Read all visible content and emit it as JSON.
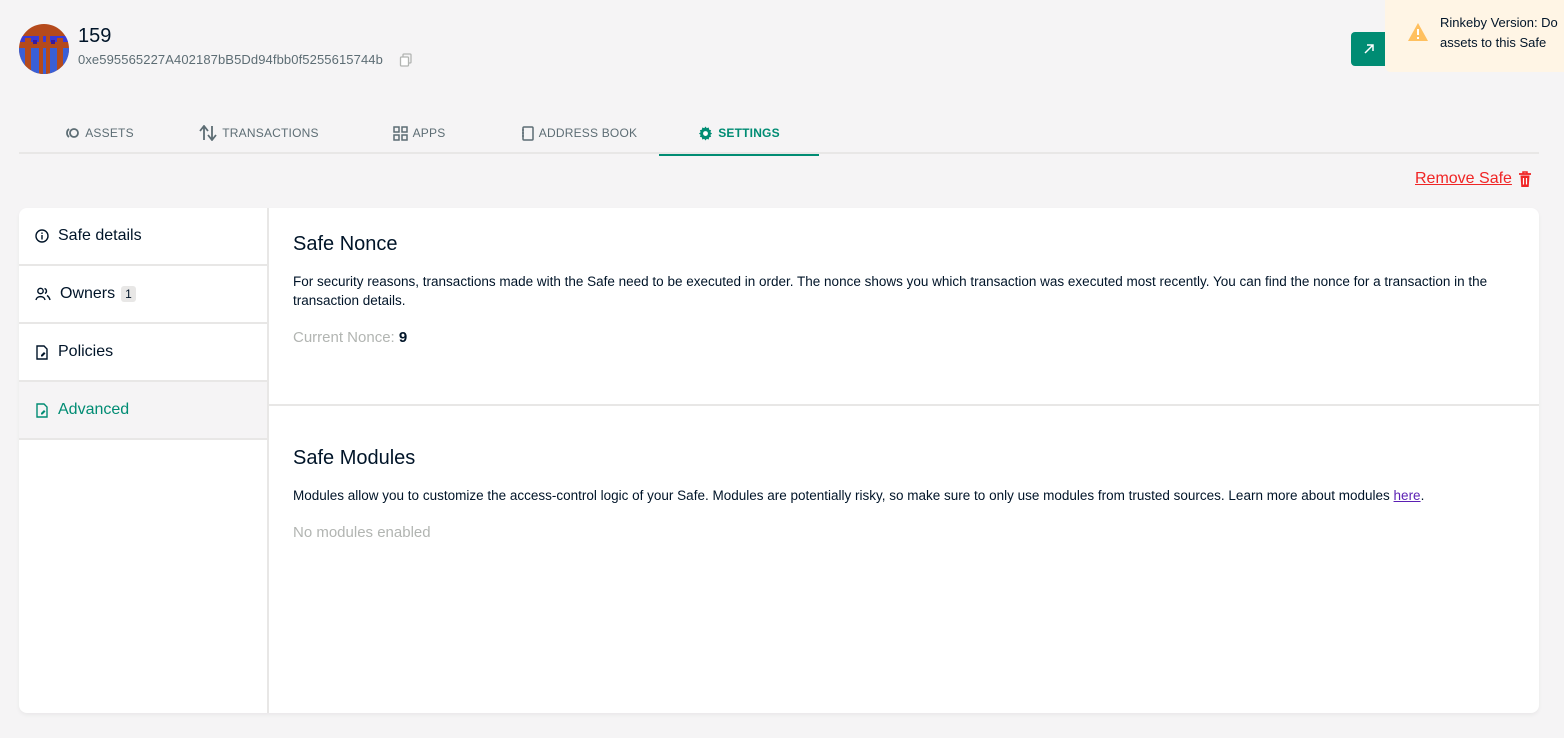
{
  "header": {
    "safe_name": "159",
    "safe_address": "0xe595565227A402187bB5Dd94fbb0f5255615744b"
  },
  "toast": {
    "line1": "Rinkeby Version: Do",
    "line2": "assets to this Safe"
  },
  "tabs": [
    {
      "label": "ASSETS",
      "icon": "assets-icon"
    },
    {
      "label": "TRANSACTIONS",
      "icon": "transactions-icon"
    },
    {
      "label": "APPS",
      "icon": "apps-icon"
    },
    {
      "label": "ADDRESS BOOK",
      "icon": "address-book-icon"
    },
    {
      "label": "SETTINGS",
      "icon": "gear-icon",
      "active": true
    }
  ],
  "remove_safe_label": "Remove Safe",
  "sidebar": {
    "items": [
      {
        "label": "Safe details",
        "icon": "info-icon"
      },
      {
        "label": "Owners",
        "icon": "owners-icon",
        "badge": "1"
      },
      {
        "label": "Policies",
        "icon": "policies-icon"
      },
      {
        "label": "Advanced",
        "icon": "advanced-icon",
        "active": true
      }
    ]
  },
  "nonce": {
    "title": "Safe Nonce",
    "description": "For security reasons, transactions made with the Safe need to be executed in order. The nonce shows you which transaction was executed most recently. You can find the nonce for a transaction in the transaction details.",
    "current_label": "Current Nonce:",
    "current_value": "9"
  },
  "modules": {
    "title": "Safe Modules",
    "description": "Modules allow you to customize the access-control logic of your Safe. Modules are potentially risky, so make sure to only use modules from trusted sources. Learn more about modules",
    "link_text": "here",
    "empty_text": "No modules enabled"
  },
  "colors": {
    "accent": "#008c73",
    "danger": "#f02525",
    "warning": "#ffc05f"
  }
}
